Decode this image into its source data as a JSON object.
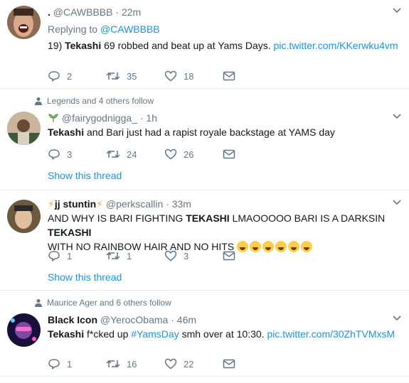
{
  "tweets": [
    {
      "name": ".",
      "handle": "@CAWBBBB",
      "time": "22m",
      "replying_prefix": "Replying to ",
      "replying_to": "@CAWBBBB",
      "text_prefix": "19) ",
      "text_bold": "Tekashi",
      "text_rest": " 69 robbed and beat up at Yams Days.  ",
      "link": "pic.twitter.com/KKerwku4vm",
      "replies": "2",
      "retweets": "35",
      "likes": "18"
    },
    {
      "social": "Legends and 4 others follow",
      "name": "",
      "handle": "@fairygodnigga_",
      "time": "1h",
      "text_bold": "Tekashi",
      "text_rest": " and Bari just had a rapist royale backstage at YAMS day",
      "replies": "3",
      "retweets": "24",
      "likes": "26",
      "thread": "Show this thread"
    },
    {
      "name": "jj stuntin",
      "handle": "@perkscallin",
      "time": "33m",
      "text_a": "AND WHY IS BARI FIGHTING ",
      "text_bold1": "TEKASHI",
      "text_b": " LMAOOOOO BARI IS A DARKSIN ",
      "text_bold2": "TEKASHI",
      "text_c": "WITH NO RAINBOW HAIR AND NO HITS ",
      "replies": "1",
      "retweets": "1",
      "likes": "3",
      "thread": "Show this thread"
    },
    {
      "social": "Maurice Ager and 6 others follow",
      "name": "Black Icon",
      "handle": "@YerocObama",
      "time": "46m",
      "text_bold": "Tekashi",
      "text_rest": " f*cked up ",
      "hashtag": "#YamsDay",
      "text_rest2": " smh over at 10:30. ",
      "link": "pic.twitter.com/30ZhTVMxsM",
      "replies": "1",
      "retweets": "16",
      "likes": "22"
    }
  ],
  "colors": {
    "link": "#1b95e0",
    "muted": "#657786",
    "border": "#e6ecf0"
  }
}
